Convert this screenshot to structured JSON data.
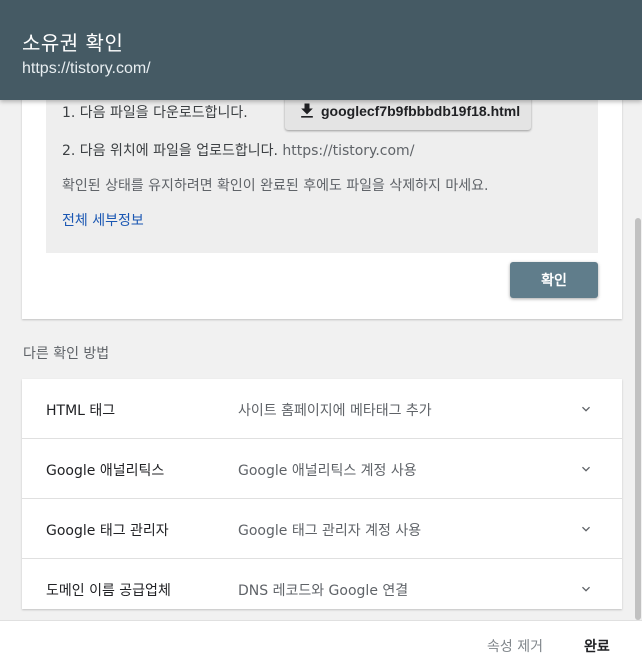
{
  "header": {
    "title": "소유권 확인",
    "subtitle": "https://tistory.com/"
  },
  "steps": {
    "step1_label": "1. 다음 파일을 다운로드합니다.",
    "download_file": "googlecf7b9fbbbdb19f18.html",
    "step2_label": "2. 다음 위치에 파일을 업로드합니다.",
    "step2_url": "https://tistory.com/",
    "note": "확인된 상태를 유지하려면 확인이 완료된 후에도 파일을 삭제하지 마세요.",
    "details_link": "전체 세부정보"
  },
  "confirm_button": "확인",
  "other_methods": {
    "label": "다른 확인 방법",
    "items": [
      {
        "name": "HTML 태그",
        "desc": "사이트 홈페이지에 메타태그 추가"
      },
      {
        "name": "Google 애널리틱스",
        "desc": "Google 애널리틱스 계정 사용"
      },
      {
        "name": "Google 태그 관리자",
        "desc": "Google 태그 관리자 계정 사용"
      },
      {
        "name": "도메인 이름 공급업체",
        "desc": "DNS 레코드와 Google 연결"
      }
    ]
  },
  "footer": {
    "remove_label": "속성 제거",
    "done_label": "완료"
  },
  "icons": {
    "download": "download-icon",
    "expand": "chevron-down-icon"
  },
  "colors": {
    "header_bg": "#455a64",
    "confirm_bg": "#607d8b",
    "link": "#1a57b3"
  }
}
